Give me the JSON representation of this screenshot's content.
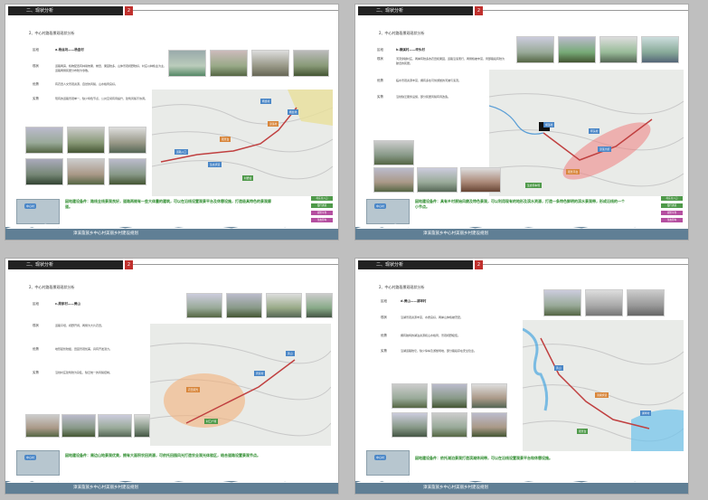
{
  "header": {
    "title": "二、现状分析",
    "num": "2"
  },
  "footer": "漳溪畲族乡中心村美丽乡村建设规划",
  "legend": [
    "村庄主入口",
    "慢行通道",
    "观景平台",
    "生态停车"
  ],
  "pages": [
    {
      "subtitle": "2、中心村路段景观现状分析",
      "section": "a.杨丝坑——杨盘村",
      "rows": [
        {
          "label": "现状",
          "text": "道路两旁，植物配置有林荫效果，梯田、果园较多，山体景观视野较好，村庄以种植业为主，道路两侧民居分布较为零散。"
        },
        {
          "label": "优势",
          "text": "有农田人文景观资源，自然的风貌，山水格局良好。"
        },
        {
          "label": "劣势",
          "text": "现有的道路景观单一，缺少特色节点，公共空间有待提升，建筑风貌不协调。"
        }
      ],
      "note": "因地建设备件：路线全线景观良好，道路两侧有一些大体量的建筑，可以在沿线设置观景平台及休憩设施，打造极具特色的景观廊道。",
      "tags": [
        "杨盘村",
        "杨丝坑",
        "漳溪村",
        "道路入口",
        "观景台",
        "生态步道",
        "村委会"
      ]
    },
    {
      "subtitle": "2、中心村路段景观现状分析",
      "section": "b.横溪村——坪头村",
      "rows": [
        {
          "label": "现状",
          "text": "河流穿越村庄，两岸有较多的农田和果园，道路沿溪而行，两侧植被丰富，局部路段有较为破旧的民居。"
        },
        {
          "label": "优势",
          "text": "临水景观资源丰富，拥有多处可供游憩的河滩与溪流。"
        },
        {
          "label": "劣势",
          "text": "沿线缺乏服务设施，部分民居风貌有待改造。"
        }
      ],
      "note": "因地建设备件：具有乡村原始风貌及特色景观，可以利用现有的地形及滨水资源，打造一条特色鲜明的滨水景观带，形成沿线的一个小节点。",
      "tags": [
        "横溪村",
        "坪头村",
        "漳溪大桥",
        "观景平台",
        "生态停车场"
      ]
    },
    {
      "subtitle": "2、中心村路段景观现状分析",
      "section": "c.周家村——黄山",
      "rows": [
        {
          "label": "现状",
          "text": "道路平坦，视野开阔，两侧为大片农田。"
        },
        {
          "label": "优势",
          "text": "地形起伏较缓，田园景观优美，具有开发潜力。"
        },
        {
          "label": "劣势",
          "text": "沿线村庄建筑较为杂乱，缺乏统一的风貌控制。"
        }
      ],
      "note": "因地建设备件：周边山地景观优美，拥有大面积农田资源，可依托田园风光打造农业观光体验区，结合道路设置景观节点。",
      "tags": [
        "周家村",
        "黄山",
        "农田观光",
        "村口广场"
      ]
    },
    {
      "subtitle": "2、中心村路段景观现状分析",
      "section": "d.黄山——湖垟村",
      "rows": [
        {
          "label": "现状",
          "text": "沿湖景观资源丰富，水质良好，两岸山体植被茂密。"
        },
        {
          "label": "优势",
          "text": "拥有独特的湖泊资源和山水格局，景观视野极佳。"
        },
        {
          "label": "劣势",
          "text": "沿湖道路较窄，缺少停车及游憩场地，部分路段存在安全隐患。"
        }
      ],
      "note": "因地建设备件：依托湖泊景观打造滨湖休闲带，可以在沿线设置观景平台和休憩设施。",
      "tags": [
        "黄山",
        "湖垟村",
        "滨湖步道",
        "观景台"
      ]
    }
  ]
}
